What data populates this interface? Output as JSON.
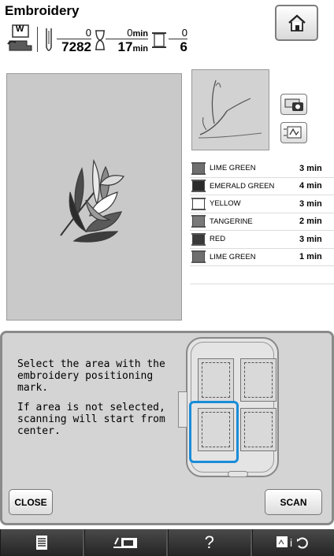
{
  "header": {
    "title": "Embroidery",
    "presser_foot_label": "W",
    "stitch_count": {
      "current": "0",
      "total": "7282"
    },
    "time": {
      "current": "0",
      "current_unit": "min",
      "total": "17",
      "total_unit": "min"
    },
    "thread_changes": {
      "current": "0",
      "total": "6"
    }
  },
  "icons": {
    "home": "home-icon",
    "presser_foot": "presser-foot-icon",
    "needle": "needle-icon",
    "hourglass": "hourglass-icon",
    "spool": "thread-spool-icon",
    "camera": "camera-icon",
    "image": "image-icon",
    "menu": "document-list-icon",
    "machine": "machine-icon",
    "help": "question-icon",
    "settings": "settings-icon"
  },
  "color_list": [
    {
      "name": "LIME GREEN",
      "time": "3 min",
      "color": "#6f6f6f"
    },
    {
      "name": "EMERALD GREEN",
      "time": "4 min",
      "color": "#2a2a2a"
    },
    {
      "name": "YELLOW",
      "time": "3 min",
      "color": "#ffffff"
    },
    {
      "name": "TANGERINE",
      "time": "2 min",
      "color": "#7a7a7a"
    },
    {
      "name": "RED",
      "time": "3 min",
      "color": "#3a3a3a"
    },
    {
      "name": "LIME GREEN",
      "time": "1 min",
      "color": "#6f6f6f"
    }
  ],
  "dialog": {
    "text_1": "Select the area with the embroidery positioning mark.",
    "text_2": "If area is not selected, scanning will start from center.",
    "close_label": "CLOSE",
    "scan_label": "SCAN",
    "selected_area": "bottom-left"
  },
  "bottom_bar": {
    "help_label": "?"
  },
  "colors": {
    "accent": "#1a8cd8",
    "panel_bg": "#d4d4d4",
    "bar_bg": "#2f2f2f"
  }
}
